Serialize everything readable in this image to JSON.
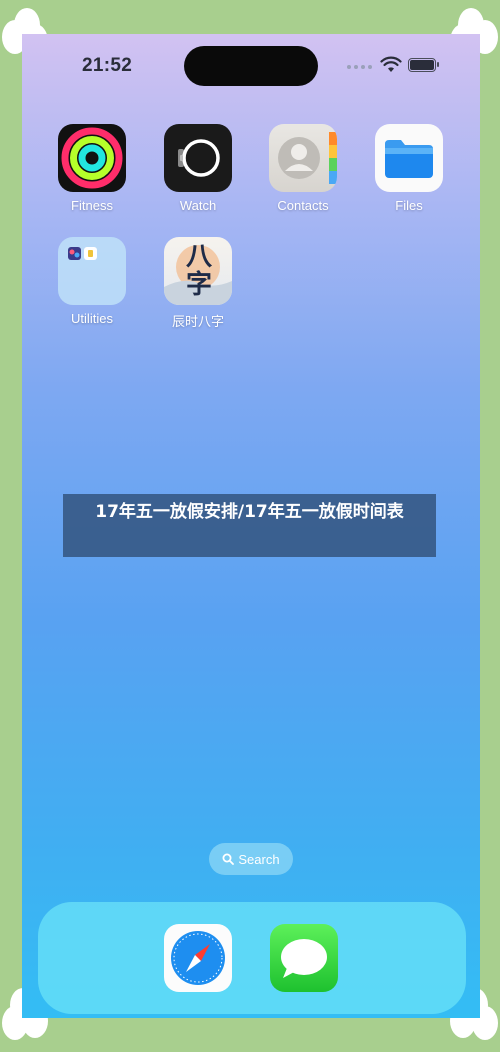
{
  "status_bar": {
    "time": "21:52"
  },
  "home_screen": {
    "apps": [
      {
        "label": "Fitness",
        "icon": "fitness-rings-icon"
      },
      {
        "label": "Watch",
        "icon": "watch-icon"
      },
      {
        "label": "Contacts",
        "icon": "contacts-icon"
      },
      {
        "label": "Files",
        "icon": "folder-icon"
      },
      {
        "label": "Utilities",
        "icon": "folder-group-icon"
      },
      {
        "label": "辰时八字",
        "icon": "bazi-app-icon",
        "icon_text": "八字"
      }
    ]
  },
  "overlay": {
    "caption": "17年五一放假安排/17年五一放假时间表"
  },
  "search": {
    "label": "Search",
    "icon": "search-icon"
  },
  "dock": {
    "apps": [
      {
        "name": "Safari",
        "icon": "safari-compass-icon"
      },
      {
        "name": "Messages",
        "icon": "messages-bubble-icon"
      }
    ]
  },
  "colors": {
    "frame": "#a8cf8e",
    "wallpaper_top": "#d2c2f2",
    "wallpaper_bottom": "#33bdf4",
    "overlay_bg": "#345682"
  }
}
